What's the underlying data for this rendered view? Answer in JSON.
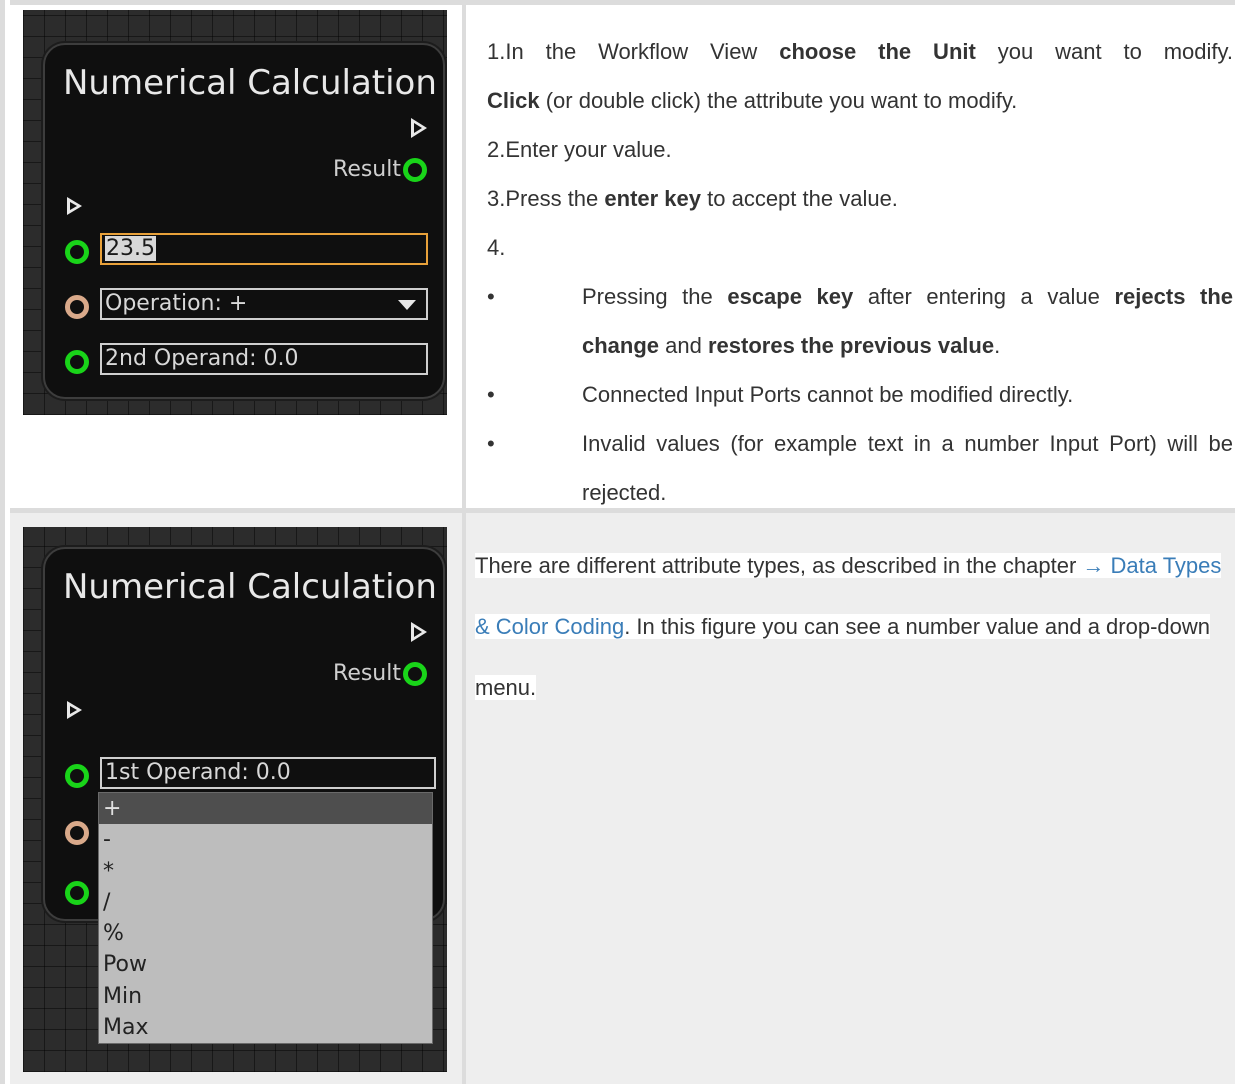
{
  "rows": [
    {
      "node": {
        "title": "Numerical Calculation",
        "result_label": "Result",
        "fields": [
          {
            "selected_text": "23.5",
            "rest": ""
          },
          {
            "text": "Operation: +"
          },
          {
            "text": "2nd Operand: 0.0"
          }
        ]
      },
      "text": {
        "line1": {
          "pre": "1.In the Workflow View ",
          "bold": "choose the Unit",
          "post": " you want to modify."
        },
        "line2": {
          "bold": "Click",
          "post": " (or double click) the attribute you want to modify."
        },
        "line3": "2.Enter your value.",
        "line4": {
          "pre": "3.Press the ",
          "bold": "enter key",
          "post": " to accept the value."
        },
        "line5": "4.",
        "bullet_mark": "•",
        "bullets": [
          {
            "pre": "Pressing the ",
            "b1": "escape key",
            "mid": " after entering a value ",
            "b2": "rejects the change",
            "and": " and ",
            "b3": "restores the previous value",
            "end": "."
          },
          {
            "text": "Connected Input Ports cannot be modified directly."
          },
          {
            "text": "Invalid values (for example text in a number Input Port) will be rejected."
          }
        ]
      }
    },
    {
      "node": {
        "title": "Numerical Calculation",
        "result_label": "Result",
        "field": "1st Operand: 0.0",
        "dropdown_options": [
          "+",
          "-",
          "*",
          "/",
          "%",
          "Pow",
          "Min",
          "Max"
        ],
        "dropdown_selected": "+"
      },
      "text": {
        "pre": "There are different attribute types, as described in the chapter ",
        "link": "→ Data Types & Color Coding",
        "post": ". In this figure you can see a number value and a drop-down menu."
      }
    }
  ],
  "colors": {
    "port_green": "#19d419",
    "port_orange": "#d9a98a",
    "active_field_border": "#e8a13a",
    "link": "#3a7db8"
  }
}
